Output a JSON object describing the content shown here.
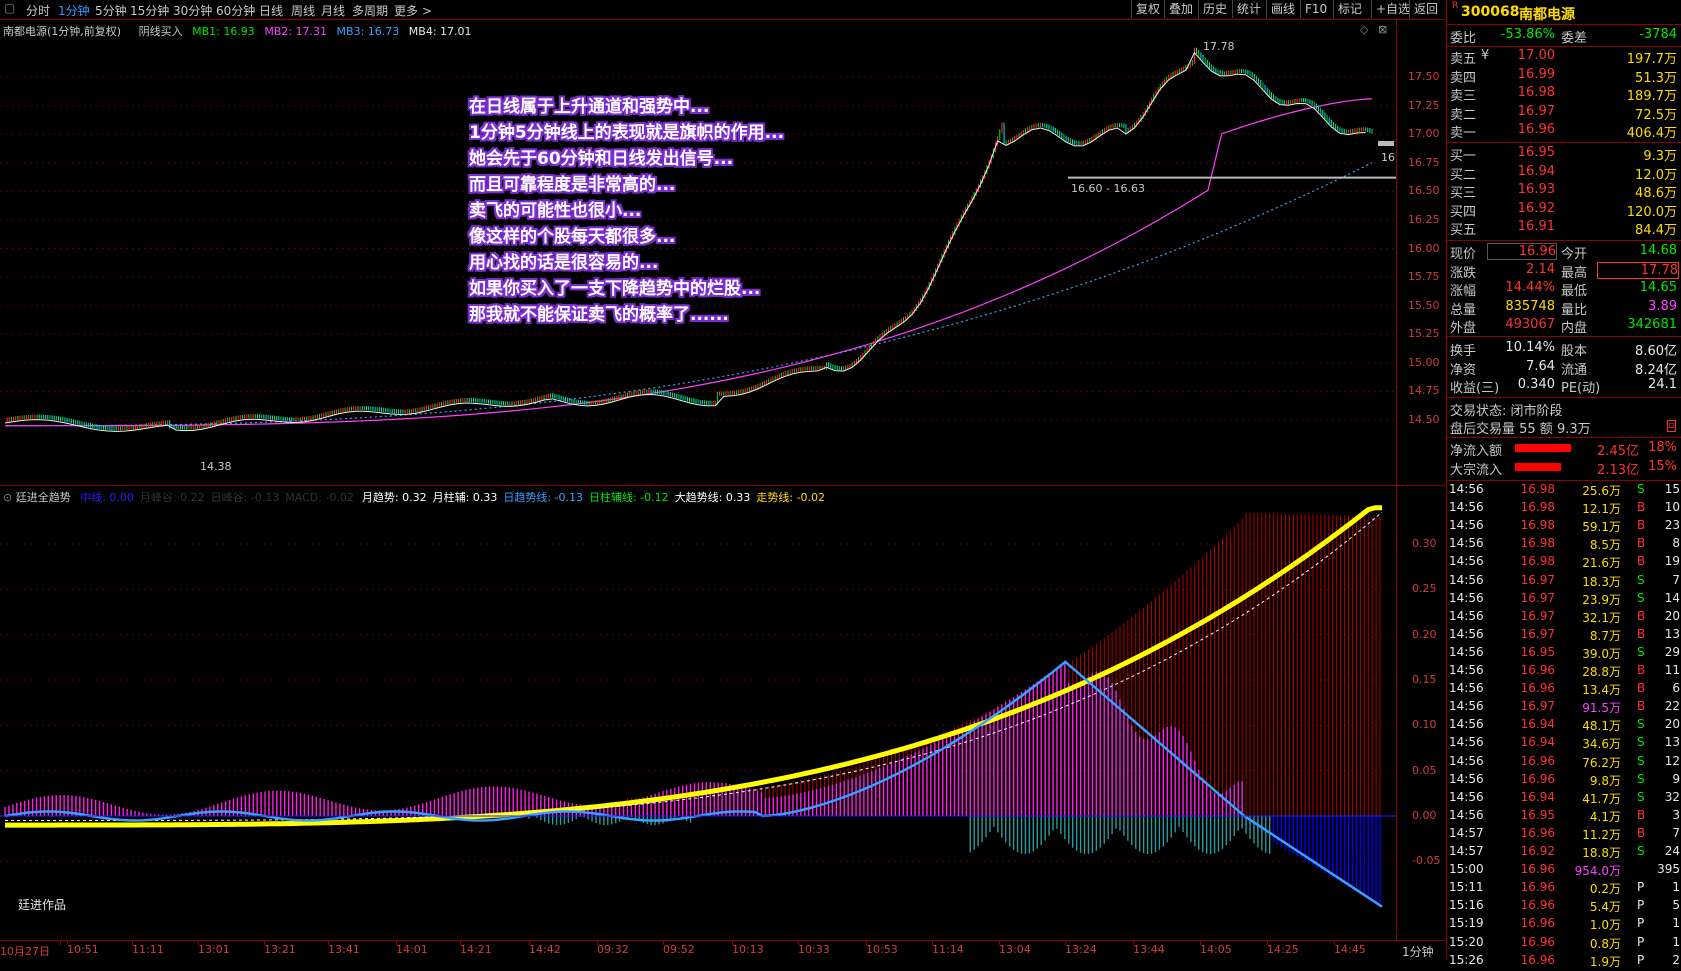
{
  "toolbar": {
    "periods": [
      "分时",
      "1分钟",
      "5分钟",
      "15分钟",
      "30分钟",
      "60分钟",
      "日线",
      "周线",
      "月线",
      "多周期",
      "更多 >"
    ],
    "active_period": "1分钟",
    "actions": [
      "复权",
      "叠加",
      "历史",
      "统计",
      "画线",
      "F10",
      "标记",
      "+自选",
      "返回"
    ]
  },
  "main_chart": {
    "title": "南都电源(1分钟,前复权)",
    "indicator_name": "阴线买入",
    "mb1_label": "MB1: 16.93",
    "mb2_label": "MB2: 17.31",
    "mb3_label": "MB3: 16.73",
    "mb4_label": "MB4: 17.01",
    "y_ticks": [
      "17.50",
      "17.25",
      "17.00",
      "16.75",
      "16.50",
      "16.25",
      "16.00",
      "15.75",
      "15.50",
      "15.25",
      "15.00",
      "14.75",
      "14.50"
    ],
    "high_annotation": "17.78",
    "low_annotation": "14.38",
    "range_annotation": "16.60 - 16.63",
    "last_price_tag": "16",
    "colors": {
      "mb1": "#00e600",
      "mb2": "#ff40ff",
      "mb3": "#3aa0ff",
      "mb4": "#e6e6e6"
    }
  },
  "overlay_text": [
    "在日线属于上升通道和强势中...",
    "1分钟5分钟线上的表现就是旗帜的作用...",
    "她会先于60分钟和日线发出信号...",
    "而且可靠程度是非常高的...",
    "卖飞的可能性也很小...",
    "像这样的个股每天都很多...",
    "用心找的话是很容易的...",
    "如果你买入了一支下降趋势中的烂股...",
    "那我就不能保证卖飞的概率了......"
  ],
  "sub_chart": {
    "indicator_name": "廷进全趋势",
    "items": [
      {
        "label": "中线: 0.00",
        "color": "#2020ff"
      },
      {
        "label": "月峰谷: 0.22",
        "color": "#333333"
      },
      {
        "label": "日峰谷: -0.13",
        "color": "#333333"
      },
      {
        "label": "MACD: -0.02",
        "color": "#333333"
      },
      {
        "label": "月趋势: 0.32",
        "color": "#ffffff"
      },
      {
        "label": "月柱辅: 0.33",
        "color": "#ffffff"
      },
      {
        "label": "日趋势线: -0.13",
        "color": "#3aa0ff"
      },
      {
        "label": "日柱辅线: -0.12",
        "color": "#00e600"
      },
      {
        "label": "大趋势线: 0.33",
        "color": "#ffffff"
      },
      {
        "label": "走势线: -0.02",
        "color": "#ffdc00"
      }
    ],
    "y_ticks": [
      "0.30",
      "0.25",
      "0.20",
      "0.15",
      "0.10",
      "0.05",
      "0.00",
      "-0.05"
    ],
    "watermark": "廷进作品"
  },
  "time_axis": {
    "labels": [
      "10月27日",
      "10:51",
      "11:11",
      "13:01",
      "13:21",
      "13:41",
      "14:01",
      "14:21",
      "14:42",
      "09:32",
      "09:52",
      "10:13",
      "10:33",
      "10:53",
      "11:14",
      "13:04",
      "13:24",
      "13:44",
      "14:05",
      "14:25",
      "14:45"
    ],
    "period_label": "1分钟"
  },
  "quote_panel": {
    "code": "300068",
    "name": "南都电源",
    "weibi_label": "委比",
    "weibi": "-53.86%",
    "weicha_label": "委差",
    "weicha": "-3784",
    "asks": [
      {
        "label": "卖五",
        "price": "17.00",
        "vol": "197.7万"
      },
      {
        "label": "卖四",
        "price": "16.99",
        "vol": "51.3万"
      },
      {
        "label": "卖三",
        "price": "16.98",
        "vol": "189.7万"
      },
      {
        "label": "卖二",
        "price": "16.97",
        "vol": "72.5万"
      },
      {
        "label": "卖一",
        "price": "16.96",
        "vol": "406.4万"
      }
    ],
    "bids": [
      {
        "label": "买一",
        "price": "16.95",
        "vol": "9.3万"
      },
      {
        "label": "买二",
        "price": "16.94",
        "vol": "12.0万"
      },
      {
        "label": "买三",
        "price": "16.93",
        "vol": "48.6万"
      },
      {
        "label": "买四",
        "price": "16.92",
        "vol": "120.0万"
      },
      {
        "label": "买五",
        "price": "16.91",
        "vol": "84.4万"
      }
    ],
    "stats": [
      {
        "l1": "现价",
        "v1": "16.96",
        "c1": "red",
        "l2": "今开",
        "v2": "14.68",
        "c2": "grn"
      },
      {
        "l1": "涨跌",
        "v1": "2.14",
        "c1": "red",
        "l2": "最高",
        "v2": "17.78",
        "c2": "red"
      },
      {
        "l1": "涨幅",
        "v1": "14.44%",
        "c1": "red",
        "l2": "最低",
        "v2": "14.65",
        "c2": "grn"
      },
      {
        "l1": "总量",
        "v1": "835748",
        "c1": "yel",
        "l2": "量比",
        "v2": "3.89",
        "c2": "mag"
      },
      {
        "l1": "外盘",
        "v1": "493067",
        "c1": "red",
        "l2": "内盘",
        "v2": "342681",
        "c2": "grn"
      }
    ],
    "stats2": [
      {
        "l1": "换手",
        "v1": "10.14%",
        "l2": "股本",
        "v2": "8.60亿"
      },
      {
        "l1": "净资",
        "v1": "7.64",
        "l2": "流通",
        "v2": "8.24亿"
      },
      {
        "l1": "收益(三)",
        "v1": "0.340",
        "l2": "PE(动)",
        "v2": "24.1"
      }
    ],
    "trade_status": "交易状态: 闭市阶段",
    "after_hours": "盘后交易量 55 额 9.3万",
    "flows": [
      {
        "label": "净流入额",
        "value": "2.45亿",
        "pct": "18%",
        "fill": 0.8
      },
      {
        "label": "大宗流入",
        "value": "2.13亿",
        "pct": "15%",
        "fill": 0.66
      }
    ],
    "ticks": [
      {
        "t": "14:56",
        "p": "16.98",
        "v": "25.6万",
        "s": "S",
        "n": "15"
      },
      {
        "t": "14:56",
        "p": "16.98",
        "v": "12.1万",
        "s": "B",
        "n": "10"
      },
      {
        "t": "14:56",
        "p": "16.98",
        "v": "59.1万",
        "s": "B",
        "n": "23"
      },
      {
        "t": "14:56",
        "p": "16.98",
        "v": "8.5万",
        "s": "B",
        "n": "8"
      },
      {
        "t": "14:56",
        "p": "16.98",
        "v": "21.6万",
        "s": "B",
        "n": "19"
      },
      {
        "t": "14:56",
        "p": "16.97",
        "v": "18.3万",
        "s": "S",
        "n": "7"
      },
      {
        "t": "14:56",
        "p": "16.97",
        "v": "23.9万",
        "s": "S",
        "n": "14"
      },
      {
        "t": "14:56",
        "p": "16.97",
        "v": "32.1万",
        "s": "B",
        "n": "20"
      },
      {
        "t": "14:56",
        "p": "16.97",
        "v": "8.7万",
        "s": "B",
        "n": "13"
      },
      {
        "t": "14:56",
        "p": "16.95",
        "v": "39.0万",
        "s": "S",
        "n": "29"
      },
      {
        "t": "14:56",
        "p": "16.96",
        "v": "28.8万",
        "s": "B",
        "n": "11"
      },
      {
        "t": "14:56",
        "p": "16.96",
        "v": "13.4万",
        "s": "B",
        "n": "6"
      },
      {
        "t": "14:56",
        "p": "16.97",
        "v": "91.5万",
        "s": "B",
        "n": "22"
      },
      {
        "t": "14:56",
        "p": "16.94",
        "v": "48.1万",
        "s": "S",
        "n": "20"
      },
      {
        "t": "14:56",
        "p": "16.94",
        "v": "34.6万",
        "s": "S",
        "n": "13"
      },
      {
        "t": "14:56",
        "p": "16.96",
        "v": "76.2万",
        "s": "S",
        "n": "12"
      },
      {
        "t": "14:56",
        "p": "16.96",
        "v": "9.8万",
        "s": "S",
        "n": "9"
      },
      {
        "t": "14:56",
        "p": "16.94",
        "v": "41.7万",
        "s": "S",
        "n": "32"
      },
      {
        "t": "14:56",
        "p": "16.95",
        "v": "4.1万",
        "s": "B",
        "n": "3"
      },
      {
        "t": "14:57",
        "p": "16.96",
        "v": "11.2万",
        "s": "B",
        "n": "7"
      },
      {
        "t": "14:57",
        "p": "16.92",
        "v": "18.8万",
        "s": "S",
        "n": "24"
      },
      {
        "t": "15:00",
        "p": "16.96",
        "v": "954.0万",
        "s": "",
        "n": "395"
      },
      {
        "t": "15:11",
        "p": "16.96",
        "v": "0.2万",
        "s": "P",
        "n": "1"
      },
      {
        "t": "15:16",
        "p": "16.96",
        "v": "5.4万",
        "s": "P",
        "n": "5"
      },
      {
        "t": "15:19",
        "p": "16.96",
        "v": "1.0万",
        "s": "P",
        "n": "1"
      },
      {
        "t": "15:20",
        "p": "16.96",
        "v": "0.8万",
        "s": "P",
        "n": "1"
      },
      {
        "t": "15:26",
        "p": "16.96",
        "v": "1.9万",
        "s": "P",
        "n": "2"
      }
    ]
  }
}
